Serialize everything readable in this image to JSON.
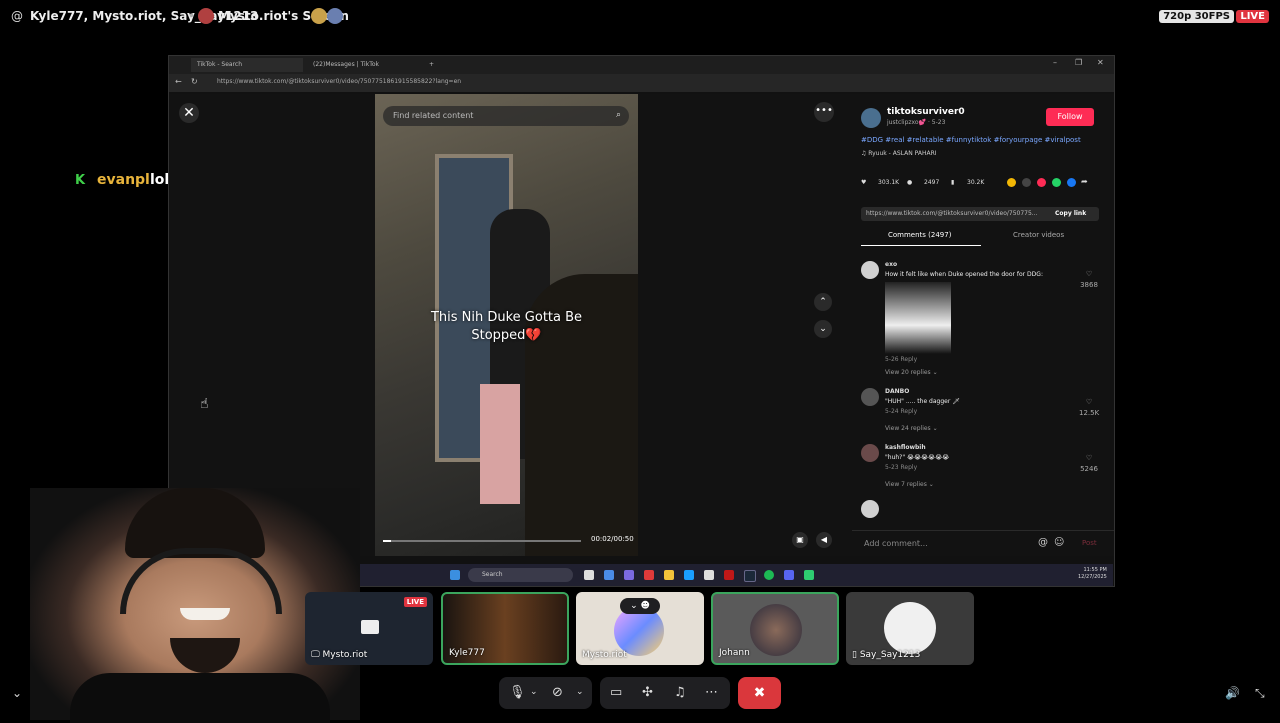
{
  "top_bar": {
    "at_symbol": "@",
    "participants": "Kyle777, Mysto.riot, Say_Say1213",
    "separator": "•",
    "screen_title": "Mysto.riot's Screen",
    "quality": "720p 30FPS",
    "live": "LIVE"
  },
  "chat": {
    "badge": "K",
    "username": "evanpl",
    "message": "lol"
  },
  "browser": {
    "tabs": [
      {
        "label": "TikTok - Search"
      },
      {
        "label": "(22)Messages | TikTok"
      }
    ],
    "new_tab": "+",
    "url": "https://www.tiktok.com/@tiktoksurviver0/video/7507751861915585822?lang=en",
    "window_controls": [
      "–",
      "❐",
      "✕"
    ]
  },
  "video": {
    "close": "✕",
    "search_placeholder": "Find related content",
    "caption_line1": "This Nih Duke Gotta Be",
    "caption_line2": "Stopped💔",
    "time": "00:02/00:50",
    "progress": 0.04
  },
  "post": {
    "username": "tiktoksurviver0",
    "handle": "justclipzxo💕 · 5-23",
    "follow": "Follow",
    "tags": "#DDG #real #relatable #funnytiktok #foryourpage #viralpost",
    "music": "♫  Ryuuk - ASLAN PAHARI",
    "likes": "303.1K",
    "comments_count": "2497",
    "saves": "30.2K",
    "link": "https://www.tiktok.com/@tiktoksurviver0/video/750775...",
    "copy_link": "Copy link",
    "tab_comments": "Comments (2497)",
    "tab_creator": "Creator videos"
  },
  "comments": [
    {
      "user": "exo",
      "text": "How it felt like when Duke opened the door for DDG:",
      "meta": "5-26   Reply",
      "replies": "View 20 replies ⌄",
      "likes": "3868"
    },
    {
      "user": "DANBO",
      "text": "\"HUH\" ..... the dagger 🗡",
      "meta": "5-24   Reply",
      "replies": "View 24 replies ⌄",
      "likes": "12.5K"
    },
    {
      "user": "kashflowbih",
      "text": "\"huh?\" 😭😭😭😭😭😭",
      "meta": "5-23   Reply",
      "replies": "View 7 replies ⌄",
      "likes": "5246"
    }
  ],
  "add_comment": {
    "placeholder": "Add comment...",
    "post": "Post"
  },
  "taskbar": {
    "search": "Search",
    "time": "11:55 PM",
    "date": "12/27/2025"
  },
  "tiles": [
    {
      "name": "Mysto.riot",
      "live": "LIVE"
    },
    {
      "name": "Kyle777"
    },
    {
      "name": "Mysto.riot"
    },
    {
      "name": "Johann"
    },
    {
      "name": "Say_Say1213"
    }
  ],
  "colors": {
    "tiktok_red": "#fe2c55",
    "speaking_green": "#3ba55d",
    "leave_red": "#da373c",
    "live_red": "#e0343f"
  }
}
